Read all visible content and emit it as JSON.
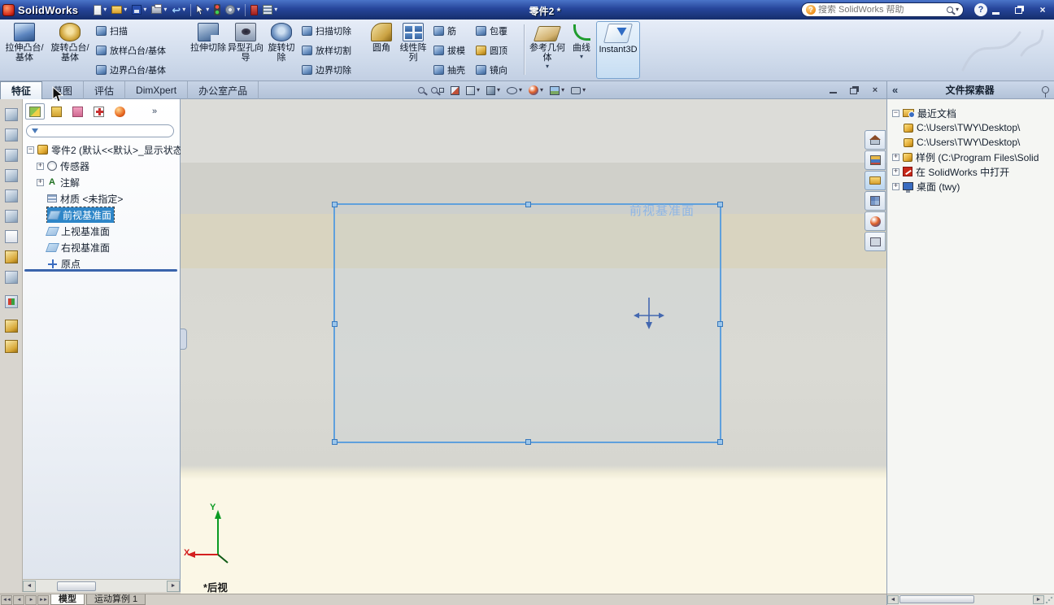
{
  "icons": {
    "dropdown": "▾",
    "plus": "+",
    "minus": "−",
    "chevrons_left": "«",
    "chevrons_right": "»",
    "close": "×",
    "help": "?",
    "undo": "↩",
    "annotation": "A",
    "scroll_left": "◄",
    "scroll_right": "►",
    "nav_first": "◄◄",
    "nav_prev": "◄",
    "nav_next": "►",
    "nav_last": "►►"
  },
  "titlebar": {
    "app_name": "SolidWorks",
    "doc_title": "零件2 *",
    "search_placeholder": "搜索 SolidWorks 帮助"
  },
  "ribbon": {
    "extrude_boss": "拉伸凸台/基体",
    "revolve_boss": "旋转凸台/基体",
    "swept_boss": "扫描",
    "loft_boss": "放样凸台/基体",
    "boundary_boss": "边界凸台/基体",
    "extrude_cut": "拉伸切除",
    "hole_wizard": "异型孔向导",
    "revolve_cut": "旋转切除",
    "swept_cut": "扫描切除",
    "loft_cut": "放样切割",
    "boundary_cut": "边界切除",
    "fillet": "圆角",
    "linear_pattern": "线性阵列",
    "rib": "筋",
    "draft": "拔模",
    "shell": "抽壳",
    "wrap": "包覆",
    "dome": "圆顶",
    "mirror": "镜向",
    "reference_geometry": "参考几何体",
    "curves": "曲线",
    "instant3d": "Instant3D"
  },
  "tabs": {
    "features": "特征",
    "sketch": "草图",
    "evaluate": "评估",
    "dimxpert": "DimXpert",
    "office": "办公室产品"
  },
  "feature_tree": {
    "root": "零件2 (默认<<默认>_显示状态",
    "sensors": "传感器",
    "annotations": "注解",
    "material": "材质 <未指定>",
    "front_plane": "前视基准面",
    "top_plane": "上视基准面",
    "right_plane": "右视基准面",
    "origin": "原点"
  },
  "viewport": {
    "plane_label": "前视基准面",
    "view_label": "*后视",
    "axis_x": "X",
    "axis_y": "Y"
  },
  "task_pane": {
    "title": "文件探索器",
    "recent_docs": "最近文档",
    "recent_file_1": "C:\\Users\\TWY\\Desktop\\",
    "recent_file_2": "C:\\Users\\TWY\\Desktop\\",
    "samples": "样例 (C:\\Program Files\\Solid",
    "open_in_sw": "在 SolidWorks 中打开",
    "desktop": "桌面 (twy)"
  },
  "bottom": {
    "model_tab": "模型",
    "motion_tab": "运动算例 1"
  }
}
